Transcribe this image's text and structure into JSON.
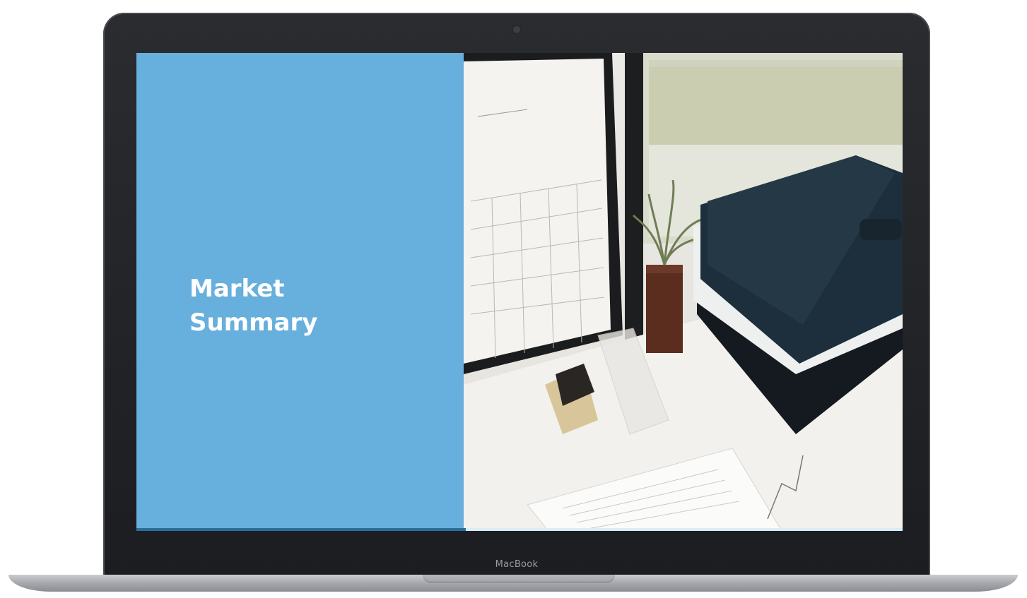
{
  "device": {
    "brand_label": "MacBook"
  },
  "slide": {
    "title_line_1": "Market",
    "title_line_2": "Summary",
    "progress": 0.43,
    "accent_color": "#67afdc",
    "title_color": "#ffffff"
  },
  "photo": {
    "description_icon": "desk-office-photo"
  }
}
